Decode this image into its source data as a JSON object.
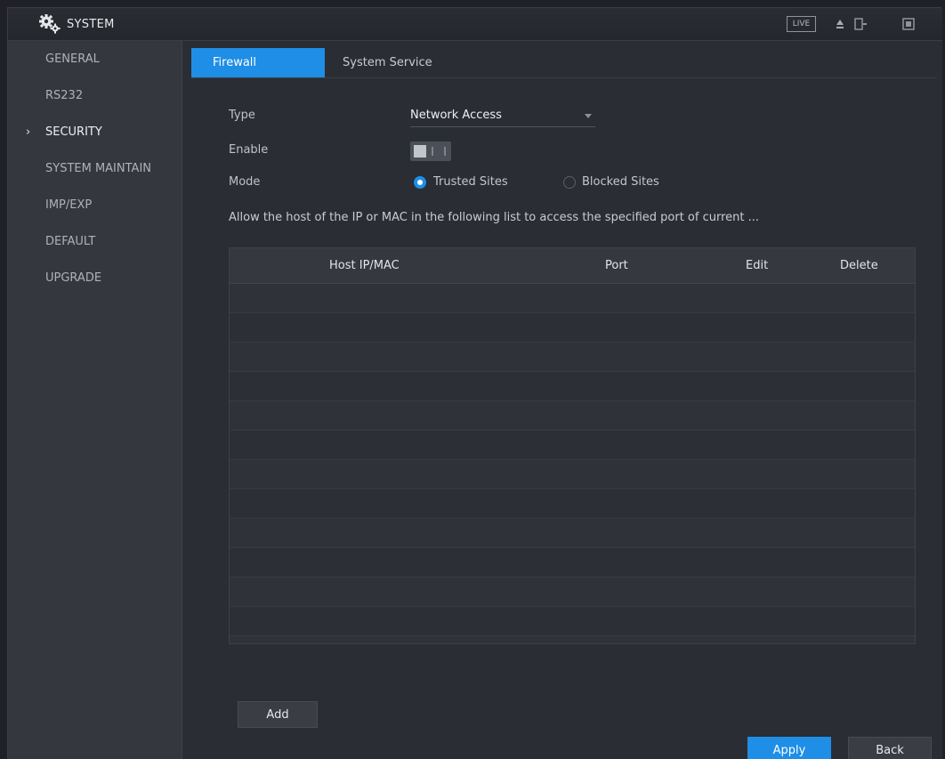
{
  "topbar": {
    "title": "SYSTEM",
    "live_label": "LIVE",
    "icons": [
      "gear-icon",
      "user-icon",
      "exit-icon",
      "fullscreen-icon"
    ]
  },
  "sidebar": {
    "items": [
      {
        "label": "GENERAL",
        "active": false
      },
      {
        "label": "RS232",
        "active": false
      },
      {
        "label": "SECURITY",
        "active": true
      },
      {
        "label": "SYSTEM MAINTAIN",
        "active": false
      },
      {
        "label": "IMP/EXP",
        "active": false
      },
      {
        "label": "DEFAULT",
        "active": false
      },
      {
        "label": "UPGRADE",
        "active": false
      }
    ]
  },
  "tabs": [
    {
      "label": "Firewall",
      "active": true
    },
    {
      "label": "System Service",
      "active": false
    }
  ],
  "form": {
    "type_label": "Type",
    "type_value": "Network Access",
    "enable_label": "Enable",
    "enable_value": false,
    "mode_label": "Mode",
    "mode_options": [
      {
        "label": "Trusted Sites",
        "selected": true
      },
      {
        "label": "Blocked Sites",
        "selected": false
      }
    ],
    "description": "Allow the host of the IP or MAC in the following list to access the specified port of current ..."
  },
  "table": {
    "columns": [
      "Host IP/MAC",
      "Port",
      "Edit",
      "Delete"
    ],
    "rows": []
  },
  "buttons": {
    "add": "Add",
    "apply": "Apply",
    "back": "Back"
  },
  "colors": {
    "accent": "#1e8ee6",
    "background": "#2a2d33",
    "sidebar": "#34373d"
  }
}
